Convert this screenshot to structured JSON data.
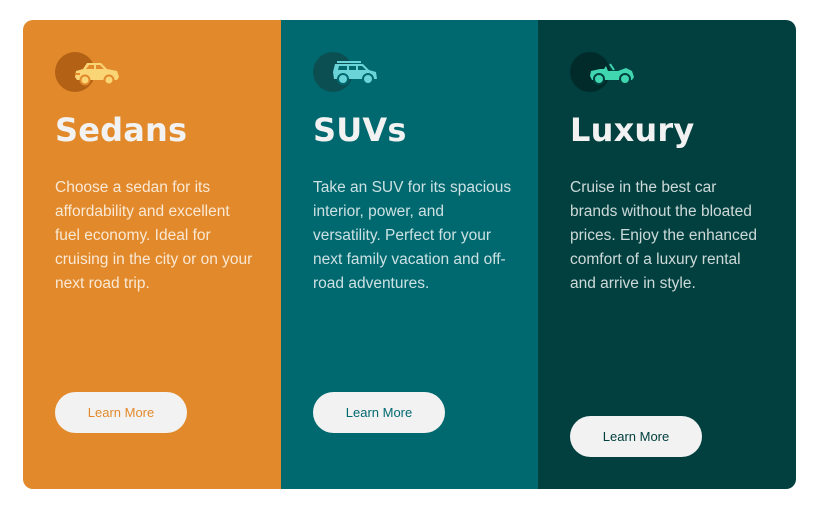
{
  "colors": {
    "sedans": "#e28a2b",
    "suvs": "#006970",
    "luxury": "#01403f",
    "button_bg": "#f2f2f2",
    "heading": "#f2f2f2"
  },
  "cards": [
    {
      "icon": "sedan-car-icon",
      "title": "Sedans",
      "text": "Choose a sedan for its affordability and excellent fuel economy. Ideal for cruising in the city or on your next road trip.",
      "button_label": "Learn More"
    },
    {
      "icon": "suv-car-icon",
      "title": "SUVs",
      "text": "Take an SUV for its spacious interior, power, and versatility. Perfect for your next family vacation and off-road adventures.",
      "button_label": "Learn More"
    },
    {
      "icon": "luxury-convertible-icon",
      "title": "Luxury",
      "text": "Cruise in the best car brands without the bloated prices. Enjoy the enhanced comfort of a luxury rental and arrive in style.",
      "button_label": "Learn More"
    }
  ]
}
